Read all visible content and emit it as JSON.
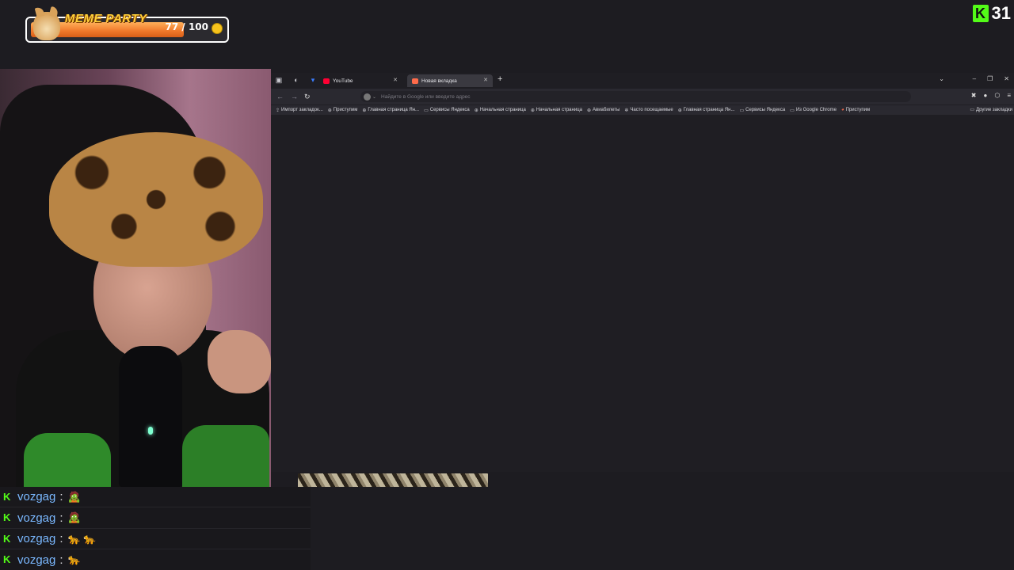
{
  "overlay": {
    "meme_party": {
      "title": "MEME PARTY",
      "count": "77 / 100",
      "progress": 0.77
    },
    "kick_badge": {
      "number": "31"
    }
  },
  "browser": {
    "tabs": [
      {
        "label": "YouTube",
        "favicon_color": "#ff0033"
      },
      {
        "label": "Новая вкладка",
        "favicon_color": "#ff6b4a"
      }
    ],
    "omnibox_placeholder": "Найдите в Google или введите адрес",
    "bookmarks": [
      {
        "label": "Импорт закладок...",
        "icon": "import-icon"
      },
      {
        "label": "Приступим",
        "icon": "globe-icon"
      },
      {
        "label": "Главная страница Ян...",
        "icon": "globe-icon"
      },
      {
        "label": "Сервисы Яндекса",
        "icon": "folder-icon"
      },
      {
        "label": "Начальная страница",
        "icon": "globe-icon"
      },
      {
        "label": "Начальная страница",
        "icon": "globe-icon"
      },
      {
        "label": "Авиабилеты",
        "icon": "globe-icon"
      },
      {
        "label": "Часто посещаемые",
        "icon": "gear-icon"
      },
      {
        "label": "Главная страница Ян...",
        "icon": "globe-icon"
      },
      {
        "label": "Сервисы Яндекса",
        "icon": "folder-icon"
      },
      {
        "label": "Из Google Chrome",
        "icon": "folder-icon"
      },
      {
        "label": "Приступим",
        "icon": "firefox-icon"
      }
    ],
    "other_bookmarks": "Другие закладки"
  },
  "chat": {
    "messages": [
      {
        "user": "vozgag",
        "emotes": "🧟"
      },
      {
        "user": "vozgag",
        "emotes": "🧟"
      },
      {
        "user": "vozgag",
        "emotes": "🐆 🐆"
      },
      {
        "user": "vozgag",
        "emotes": "🐆"
      }
    ]
  },
  "colors": {
    "kick_green": "#53fc18",
    "username_blue": "#7ab8ff",
    "progress_orange": "#f0782a"
  }
}
